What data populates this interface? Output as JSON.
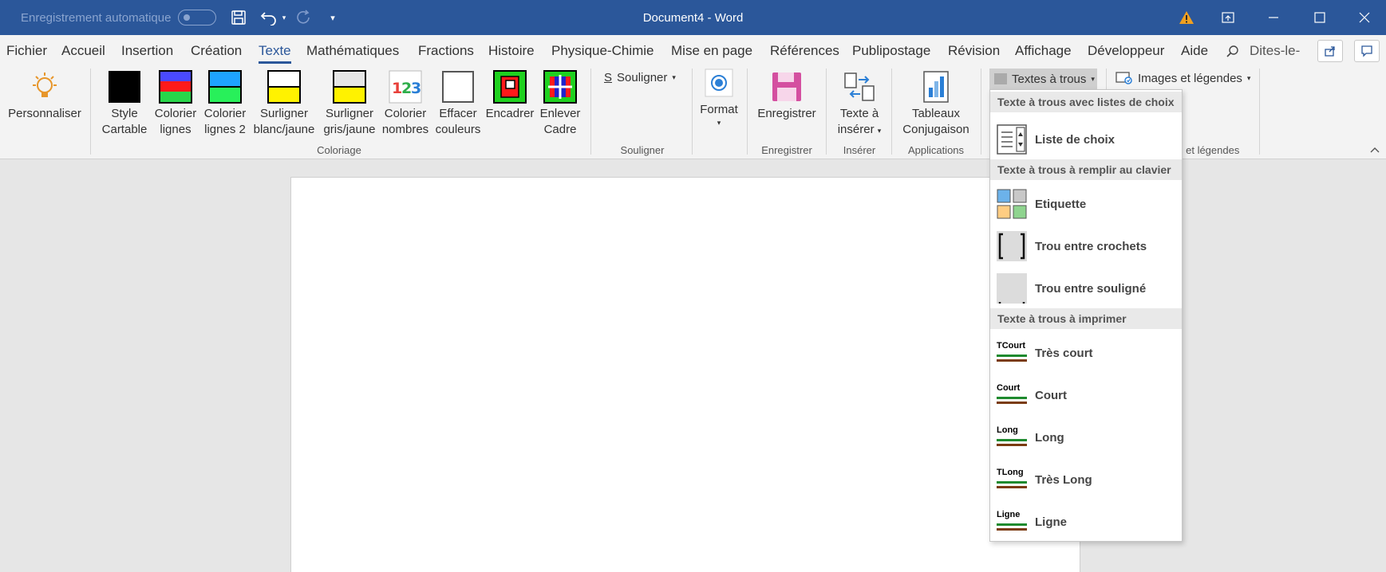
{
  "titlebar": {
    "autosave_label": "Enregistrement automatique",
    "document_title": "Document4  -  Word"
  },
  "menu": {
    "tabs": [
      "Fichier",
      "Accueil",
      "Insertion",
      "Création",
      "Texte",
      "Mathématiques",
      "Fractions",
      "Histoire",
      "Physique-Chimie",
      "Mise en page",
      "Références",
      "Publipostage",
      "Révision",
      "Affichage",
      "Développeur",
      "Aide"
    ],
    "active_tab": "Texte",
    "tell_me": "Dites-le-"
  },
  "ribbon": {
    "personnaliser": "Personnaliser",
    "coloriage": {
      "label": "Coloriage",
      "buttons": [
        {
          "line1": "Style",
          "line2": "Cartable"
        },
        {
          "line1": "Colorier",
          "line2": "lignes"
        },
        {
          "line1": "Colorier",
          "line2": "lignes 2"
        },
        {
          "line1": "Surligner",
          "line2": "blanc/jaune"
        },
        {
          "line1": "Surligner",
          "line2": "gris/jaune"
        },
        {
          "line1": "Colorier",
          "line2": "nombres"
        },
        {
          "line1": "Effacer",
          "line2": "couleurs"
        },
        {
          "line1": "Encadrer",
          "line2": ""
        },
        {
          "line1": "Enlever",
          "line2": "Cadre"
        }
      ]
    },
    "souligner": {
      "label": "Souligner",
      "button": "Souligner"
    },
    "format": {
      "button": "Format"
    },
    "enregistrer": {
      "label": "Enregistrer",
      "button": "Enregistrer"
    },
    "inserer": {
      "label": "Insérer",
      "line1": "Texte à",
      "line2": "insérer"
    },
    "applications": {
      "label": "Applications",
      "line1": "Tableaux",
      "line2": "Conjugaison"
    },
    "textes_a_trous": {
      "button": "Textes à trous"
    },
    "images": {
      "button": "Images et légendes",
      "label_partial": "s et légendes"
    }
  },
  "dropdown": {
    "sections": [
      {
        "header": "Texte à trous avec listes de choix",
        "items": [
          "Liste de choix"
        ]
      },
      {
        "header": "Texte à trous à remplir au clavier",
        "items": [
          "Etiquette",
          "Trou entre crochets",
          "Trou entre souligné"
        ]
      },
      {
        "header": "Texte à trous à imprimer",
        "items": [
          "Très court",
          "Court",
          "Long",
          "Très Long",
          "Ligne"
        ]
      }
    ],
    "icon_tags": [
      "TCourt",
      "Court",
      "Long",
      "TLong",
      "Ligne"
    ]
  },
  "colors": {
    "title_bar": "#2b579a",
    "ribbon_bg": "#f3f3f3",
    "accent": "#2b579a"
  }
}
